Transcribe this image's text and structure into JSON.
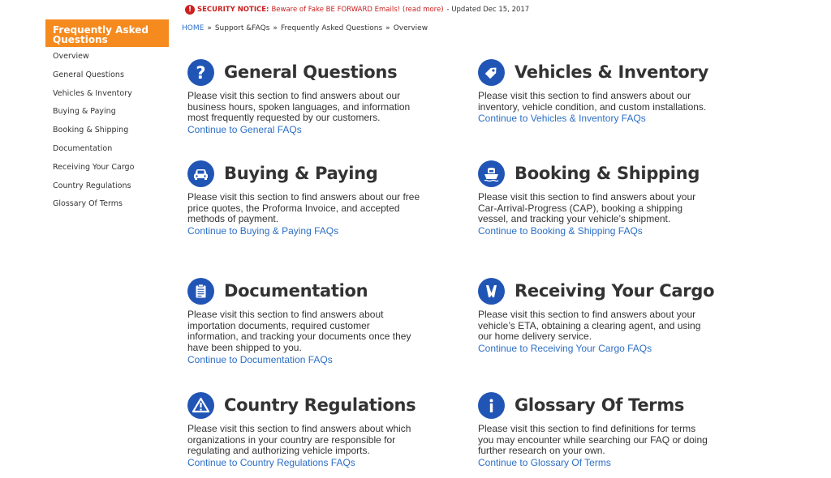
{
  "notice": {
    "icon": "alert-icon",
    "label": "SECURITY NOTICE:",
    "text": "Beware of Fake BE FORWARD Emails!",
    "link": "(read more)",
    "updated": "- Updated Dec 15, 2017"
  },
  "breadcrumb": {
    "home": "HOME",
    "separator": "»",
    "items": [
      "Support &FAQs",
      "Frequently Asked Questions",
      "Overview"
    ]
  },
  "sidebar": {
    "header": "Frequently Asked Questions",
    "items": [
      {
        "label": "Overview"
      },
      {
        "label": "General Questions"
      },
      {
        "label": "Vehicles & Inventory"
      },
      {
        "label": "Buying & Paying"
      },
      {
        "label": "Booking & Shipping"
      },
      {
        "label": "Documentation"
      },
      {
        "label": "Receiving Your Cargo"
      },
      {
        "label": "Country Regulations"
      },
      {
        "label": "Glossary Of Terms"
      }
    ]
  },
  "sections": [
    {
      "icon": "question-icon",
      "title": "General Questions",
      "description": "Please visit this section to find answers about our business hours, spoken languages, and information most frequently requested by our customers.",
      "link": "Continue to General FAQs"
    },
    {
      "icon": "tag-icon",
      "title": "Vehicles & Inventory",
      "description": "Please visit this section to find answers about our inventory, vehicle condition, and custom installations.",
      "link": "Continue to Vehicles & Inventory FAQs"
    },
    {
      "icon": "car-icon",
      "title": "Buying & Paying",
      "description": "Please visit this section to find answers about our free price quotes, the Proforma Invoice, and accepted methods of payment.",
      "link": "Continue to Buying & Paying FAQs"
    },
    {
      "icon": "ship-icon",
      "title": "Booking & Shipping",
      "description": "Please visit this section to find answers about your Car-Arrival-Progress (CAP), booking a shipping vessel, and tracking your vehicle’s shipment.",
      "link": "Continue to Booking & Shipping FAQs"
    },
    {
      "icon": "clipboard-icon",
      "title": "Documentation",
      "description": "Please visit this section to find answers about importation documents, required customer information, and tracking your documents once they have been shipped to you.",
      "link": "Continue to Documentation FAQs"
    },
    {
      "icon": "tools-icon",
      "title": "Receiving Your Cargo",
      "description": "Please visit this section to find answers about your vehicle’s ETA, obtaining a clearing agent, and using our home delivery service.",
      "link": "Continue to Receiving Your Cargo FAQs"
    },
    {
      "icon": "warning-icon",
      "title": "Country Regulations",
      "description": "Please visit this section to find answers about which organizations in your country are responsible for regulating and authorizing vehicle imports.",
      "link": "Continue to Country Regulations FAQs"
    },
    {
      "icon": "info-icon",
      "title": "Glossary Of Terms",
      "description": "Please visit this section to find definitions for terms you may encounter while searching our FAQ or doing further research on your own.",
      "link": "Continue to Glossary Of Terms"
    }
  ]
}
